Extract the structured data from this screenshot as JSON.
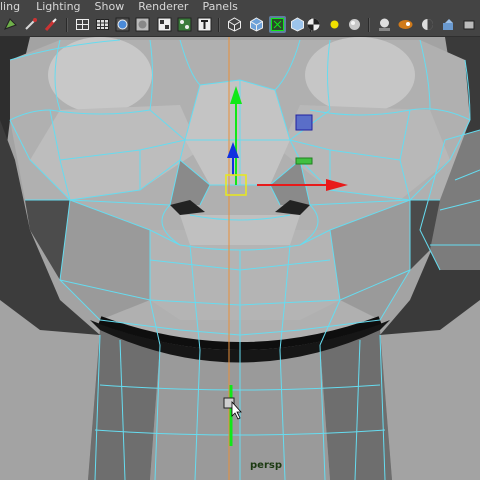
{
  "menubar": {
    "items": [
      {
        "label": "ling"
      },
      {
        "label": "Lighting"
      },
      {
        "label": "Show"
      },
      {
        "label": "Renderer"
      },
      {
        "label": "Panels"
      }
    ]
  },
  "toolbar": {
    "icons": [
      "select-camera-icon",
      "lasso-icon",
      "brush-icon",
      "wireframe-icon",
      "grid-icon",
      "smooth-shade-icon",
      "flat-shade-icon",
      "texture-icon",
      "text-icon",
      "isolate-icon",
      "shaded-cube-icon",
      "xray-icon",
      "wire-on-shaded-icon",
      "checker-icon",
      "light-bulb-icon",
      "sphere-icon",
      "default-lights-icon",
      "render-icon",
      "half-sphere-icon",
      "ambient-occlusion-icon"
    ]
  },
  "viewport": {
    "camera_label": "persp"
  },
  "colors": {
    "wire": "#66dcf0",
    "x_axis": "#e81a1a",
    "y_axis": "#10e818",
    "z_axis": "#1030e0",
    "pivot": "#e8e81a",
    "toolbar_bg": "#444444"
  }
}
